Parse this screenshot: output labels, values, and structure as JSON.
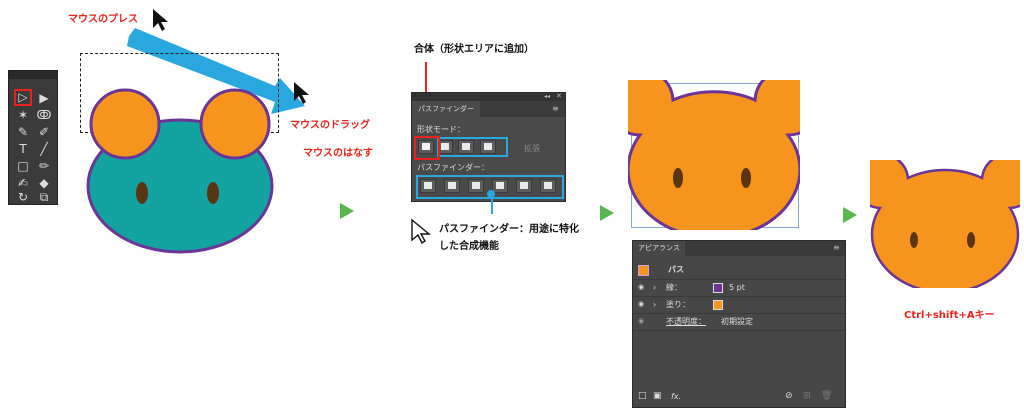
{
  "labels": {
    "mouse_press": "マウスのプレス",
    "mouse_drag": "マウスのドラッグ",
    "mouse_release": "マウスのはなす",
    "unite": "合体（形状エリアに追加）",
    "pathfinder_desc_line1": "パスファインダー：用途に特化",
    "pathfinder_desc_line2": "した合成機能",
    "shortcut": "Ctrl+shift+Aキー"
  },
  "pathfinder_panel": {
    "tab": "パスファインダー",
    "shape_modes": "形状モード：",
    "expand": "拡張",
    "pathfinders": "パスファインダー："
  },
  "appearance_panel": {
    "tab": "アピアランス",
    "object": "パス",
    "stroke_label": "線：",
    "stroke_value": "5 pt",
    "fill_label": "塗り：",
    "opacity_label": "不透明度：",
    "opacity_value": "初期設定",
    "fx": "fx."
  },
  "colors": {
    "red": "#e8231c",
    "blue": "#29a8e0",
    "teal": "#13a3a0",
    "orange": "#f7941e",
    "purple": "#6a3596",
    "eye": "#5a3514",
    "next_arrow": "#56b84c"
  }
}
